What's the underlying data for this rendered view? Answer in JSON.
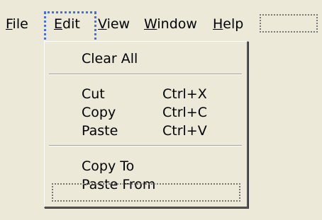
{
  "menubar": {
    "items": [
      {
        "label": "File",
        "mnemonic": "F"
      },
      {
        "label": "Edit",
        "mnemonic": "E"
      },
      {
        "label": "View",
        "mnemonic": "V"
      },
      {
        "label": "Window",
        "mnemonic": "W"
      },
      {
        "label": "Help",
        "mnemonic": "H"
      }
    ]
  },
  "edit_menu": {
    "items": [
      {
        "label": "Clear All",
        "shortcut": ""
      },
      {
        "label": "Cut",
        "shortcut": "Ctrl+X"
      },
      {
        "label": "Copy",
        "shortcut": "Ctrl+C"
      },
      {
        "label": "Paste",
        "shortcut": "Ctrl+V"
      },
      {
        "label": "Copy To",
        "shortcut": ""
      },
      {
        "label": "Paste From",
        "shortcut": ""
      }
    ]
  },
  "colors": {
    "background": "#ece9d8",
    "focus_outline": "#3f6fe0"
  }
}
